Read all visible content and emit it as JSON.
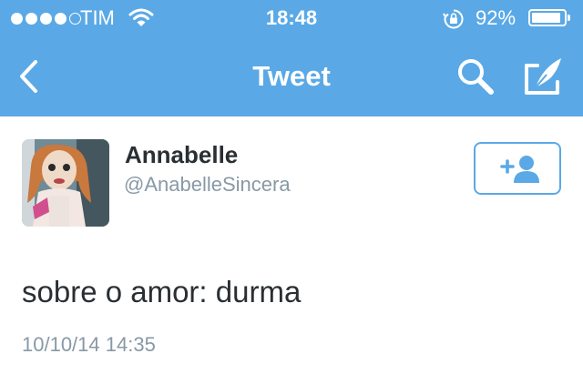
{
  "status_bar": {
    "carrier": "TIM",
    "signal_bars_filled": 4,
    "signal_bars_total": 5,
    "time": "18:48",
    "battery_percent": "92%",
    "battery_level": 0.92
  },
  "nav": {
    "title": "Tweet",
    "icons": [
      "back-chevron-icon",
      "search-icon",
      "compose-icon"
    ]
  },
  "tweet": {
    "author_name": "Annabelle",
    "author_handle": "@AnabelleSincera",
    "text": "sobre o amor: durma",
    "timestamp": "10/10/14 14:35"
  },
  "follow_button": {
    "icon": "add-user-icon"
  },
  "colors": {
    "bar": "#5aa9e6",
    "text": "#292f33",
    "muted": "#8899a6",
    "accent": "#5aa9e6"
  }
}
